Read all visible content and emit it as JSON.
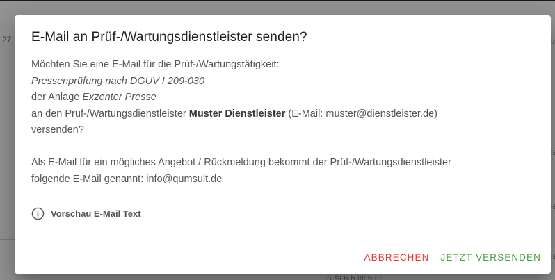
{
  "background": {
    "fragments": [
      "27",
      "la",
      "la",
      "la",
      "la"
    ],
    "bottom_text": "ü   Si h  h itli h  t  l"
  },
  "dialog": {
    "title": "E-Mail an Prüf-/Wartungsdienstleister senden?",
    "intro": "Möchten Sie eine E-Mail für die Prüf-/Wartungstätigkeit:",
    "activity": "Pressenprüfung nach DGUV I 209-030",
    "asset_prefix": "der Anlage ",
    "asset_name": "Exzenter Presse",
    "provider_prefix": "an den Prüf-/Wartungsdienstleister ",
    "provider_name": "Muster Dienstleister",
    "provider_email_text": " (E-Mail: muster@dienstleister.de)",
    "send_question": "versenden?",
    "reply_line_1": "Als E-Mail für ein mögliches Angebot / Rückmeldung bekommt der Prüf-/Wartungsdienstleister",
    "reply_line_2": "folgende E-Mail genannt: info@qumsult.de",
    "preview_label": "Vorschau E-Mail Text",
    "preview_icon": "info-circle-icon",
    "cancel_label": "ABBRECHEN",
    "send_label": "JETZT VERSENDEN"
  },
  "colors": {
    "cancel": "#e53935",
    "confirm": "#43a047"
  }
}
